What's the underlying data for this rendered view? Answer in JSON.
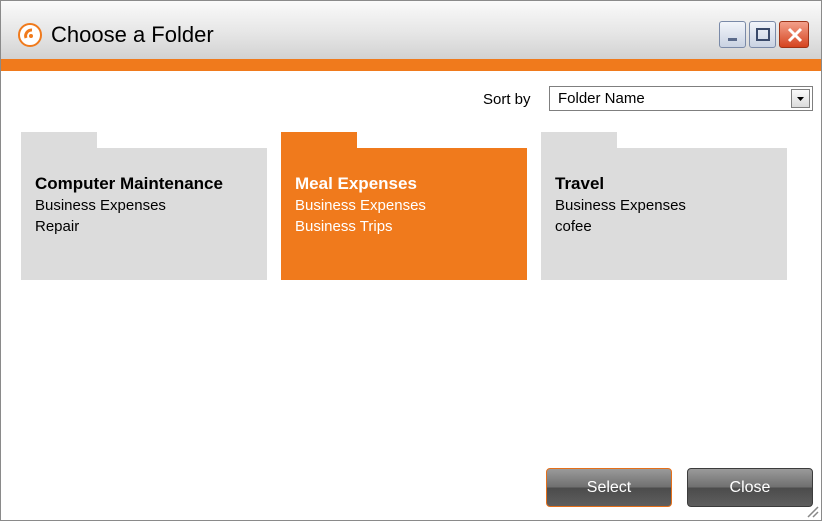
{
  "window": {
    "title": "Choose a Folder",
    "accent_color": "#f07a1c",
    "controls": [
      "minimize-icon",
      "maximize-icon",
      "close-icon"
    ]
  },
  "sort": {
    "label": "Sort by",
    "selected": "Folder Name"
  },
  "folders": [
    {
      "name": "Computer Maintenance",
      "line1": "Business Expenses",
      "line2": "Repair",
      "selected": false
    },
    {
      "name": "Meal Expenses",
      "line1": "Business Expenses",
      "line2": "Business Trips",
      "selected": true
    },
    {
      "name": "Travel",
      "line1": "Business Expenses",
      "line2": "cofee",
      "selected": false
    }
  ],
  "buttons": {
    "select_label": "Select",
    "close_label": "Close"
  }
}
